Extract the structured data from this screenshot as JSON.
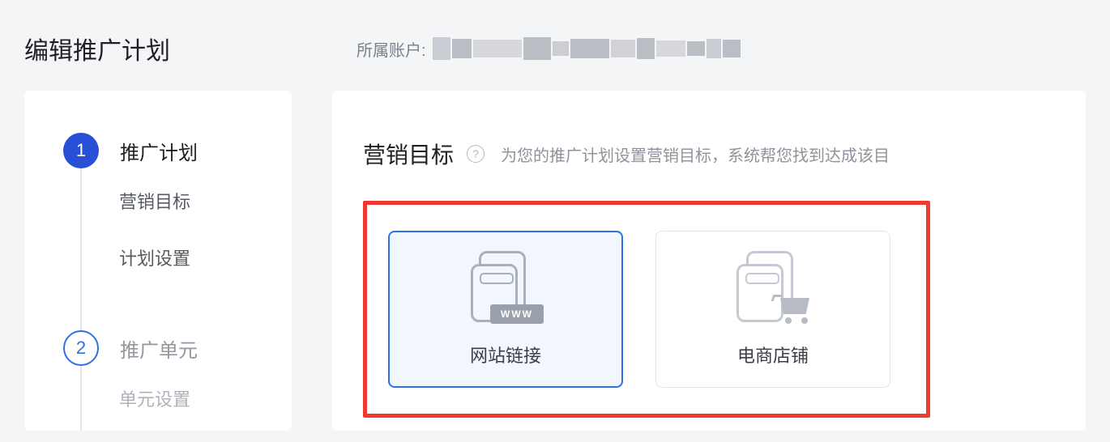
{
  "header": {
    "title": "编辑推广计划",
    "account_label": "所属账户:"
  },
  "sidebar": {
    "steps": [
      {
        "number": "1",
        "label": "推广计划",
        "active": true,
        "sub_items": [
          "营销目标",
          "计划设置"
        ]
      },
      {
        "number": "2",
        "label": "推广单元",
        "active": false,
        "sub_items": [
          "单元设置"
        ]
      }
    ]
  },
  "main": {
    "section_title": "营销目标",
    "help_symbol": "?",
    "section_desc": "为您的推广计划设置营销目标，系统帮您找到达成该目",
    "options": [
      {
        "label": "网站链接",
        "selected": true,
        "www_badge": "WWW"
      },
      {
        "label": "电商店铺",
        "selected": false
      }
    ]
  }
}
